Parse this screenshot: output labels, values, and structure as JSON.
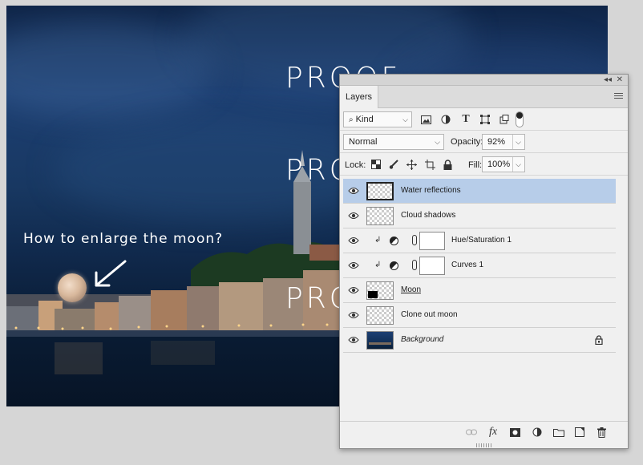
{
  "canvas": {
    "watermark": "PROOF",
    "question": "How to enlarge the moon?"
  },
  "panel": {
    "collapse_glyph": "◂◂",
    "close_glyph": "✕",
    "tab_label": "Layers",
    "filter": {
      "kind_label": "Kind",
      "icons": [
        "image-filter-icon",
        "adjustment-filter-icon",
        "type-filter-icon",
        "shape-filter-icon",
        "smart-object-filter-icon",
        "filter-toggle-icon"
      ]
    },
    "blend": {
      "mode": "Normal",
      "opacity_label": "Opacity:",
      "opacity_value": "92%"
    },
    "lock": {
      "label": "Lock:",
      "fill_label": "Fill:",
      "fill_value": "100%"
    },
    "layers": [
      {
        "name": "Water reflections",
        "type": "pixel",
        "selected": true
      },
      {
        "name": "Cloud shadows",
        "type": "pixel",
        "selected": false
      },
      {
        "name": "Hue/Saturation 1",
        "type": "adjustment",
        "selected": false
      },
      {
        "name": "Curves 1",
        "type": "adjustment",
        "selected": false
      },
      {
        "name": "Moon",
        "type": "pixel",
        "selected": false
      },
      {
        "name": "Clone out moon",
        "type": "pixel",
        "selected": false
      },
      {
        "name": "Background",
        "type": "background",
        "selected": false
      }
    ],
    "footer_icons": [
      "link-layers-icon",
      "fx-icon",
      "add-mask-icon",
      "new-adjustment-icon",
      "new-group-icon",
      "new-layer-icon",
      "delete-layer-icon"
    ],
    "colors": {
      "selected_row": "#b7cde9",
      "panel_bg": "#f0f0f0"
    }
  }
}
